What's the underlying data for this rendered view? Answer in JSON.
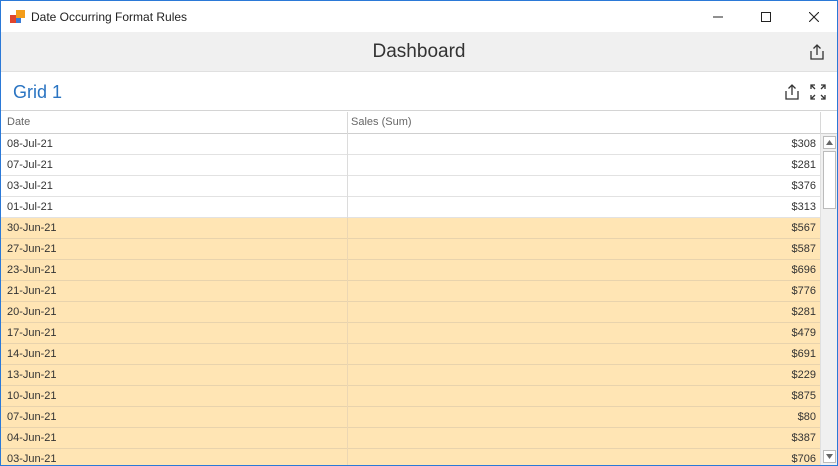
{
  "window": {
    "title": "Date Occurring Format Rules",
    "minimize_icon": "minimize-icon",
    "maximize_icon": "maximize-icon",
    "close_icon": "close-icon"
  },
  "dashboard": {
    "title": "Dashboard",
    "export_icon": "export-icon"
  },
  "grid": {
    "title": "Grid 1",
    "export_icon": "export-icon",
    "maximize_icon": "maximize-icon",
    "columns": [
      "Date",
      "Sales (Sum)"
    ],
    "highlight_color": "#ffe5b4",
    "rows": [
      {
        "date": "08-Jul-21",
        "sales": "$308",
        "highlighted": false
      },
      {
        "date": "07-Jul-21",
        "sales": "$281",
        "highlighted": false
      },
      {
        "date": "03-Jul-21",
        "sales": "$376",
        "highlighted": false
      },
      {
        "date": "01-Jul-21",
        "sales": "$313",
        "highlighted": false
      },
      {
        "date": "30-Jun-21",
        "sales": "$567",
        "highlighted": true
      },
      {
        "date": "27-Jun-21",
        "sales": "$587",
        "highlighted": true
      },
      {
        "date": "23-Jun-21",
        "sales": "$696",
        "highlighted": true
      },
      {
        "date": "21-Jun-21",
        "sales": "$776",
        "highlighted": true
      },
      {
        "date": "20-Jun-21",
        "sales": "$281",
        "highlighted": true
      },
      {
        "date": "17-Jun-21",
        "sales": "$479",
        "highlighted": true
      },
      {
        "date": "14-Jun-21",
        "sales": "$691",
        "highlighted": true
      },
      {
        "date": "13-Jun-21",
        "sales": "$229",
        "highlighted": true
      },
      {
        "date": "10-Jun-21",
        "sales": "$875",
        "highlighted": true
      },
      {
        "date": "07-Jun-21",
        "sales": "$80",
        "highlighted": true
      },
      {
        "date": "04-Jun-21",
        "sales": "$387",
        "highlighted": true
      },
      {
        "date": "03-Jun-21",
        "sales": "$706",
        "highlighted": true
      }
    ]
  },
  "colors": {
    "accent": "#2a74c2",
    "window_border": "#2b79d7"
  }
}
